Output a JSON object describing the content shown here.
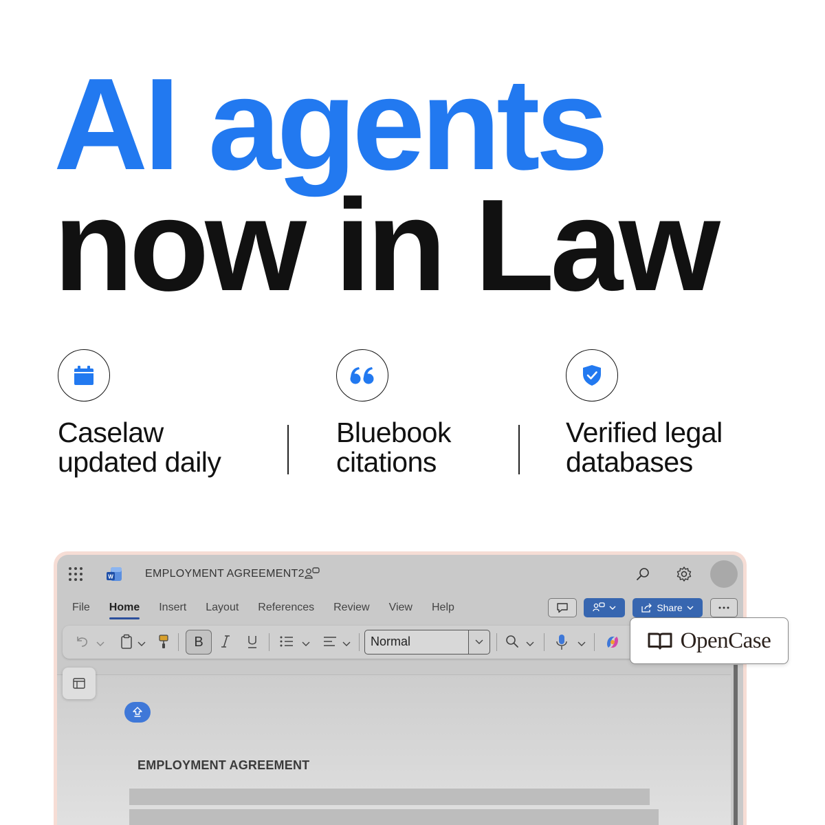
{
  "headline": {
    "line1": "AI agents",
    "line2": "now in Law"
  },
  "features": [
    {
      "icon": "calendar-icon",
      "line1": "Caselaw",
      "line2": "updated daily"
    },
    {
      "icon": "quote-icon",
      "line1": "Bluebook",
      "line2": "citations"
    },
    {
      "icon": "shield-check-icon",
      "line1": "Verified legal",
      "line2": "databases"
    }
  ],
  "colors": {
    "accent": "#2279f0",
    "text": "#111111",
    "window_outline": "#f6ddd5",
    "word_blue": "#3766b0"
  },
  "app": {
    "doc_title": "EMPLOYMENT AGREEMENT2",
    "tabs": [
      "File",
      "Home",
      "Insert",
      "Layout",
      "References",
      "Review",
      "View",
      "Help"
    ],
    "active_tab": "Home",
    "share_label": "Share",
    "bold_label": "B",
    "style_value": "Normal",
    "document_heading": "EMPLOYMENT AGREEMENT"
  },
  "overlay": {
    "brand": "OpenCase"
  }
}
